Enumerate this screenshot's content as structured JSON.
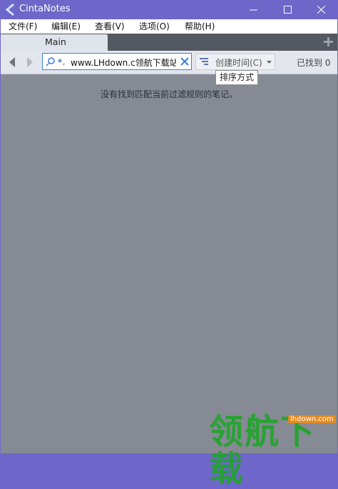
{
  "window": {
    "title": "CintaNotes"
  },
  "menu": [
    {
      "label": "文件(F)"
    },
    {
      "label": "编辑(E)"
    },
    {
      "label": "查看(V)"
    },
    {
      "label": "选项(O)"
    },
    {
      "label": "帮助(H)"
    }
  ],
  "tabs": {
    "active": "Main",
    "add_icon": "plus-icon"
  },
  "toolbar": {
    "search_value": "www.LHdown.c领航下载站",
    "sort_label": "创建时间(C)",
    "found_text": "已找到 0"
  },
  "tooltip": {
    "text": "排序方式"
  },
  "main": {
    "empty_message": "没有找到匹配当前过滤规则的笔记。"
  },
  "watermark": {
    "logo_text": "领航下载",
    "site": "lhdown.com"
  },
  "colors": {
    "titlebar": "#6f66c9",
    "content_bg": "#868a94",
    "tab_active": "#dfe3ea",
    "tabbar": "#545860",
    "accent": "#3d7fe0",
    "watermark": "#1fa52a"
  }
}
